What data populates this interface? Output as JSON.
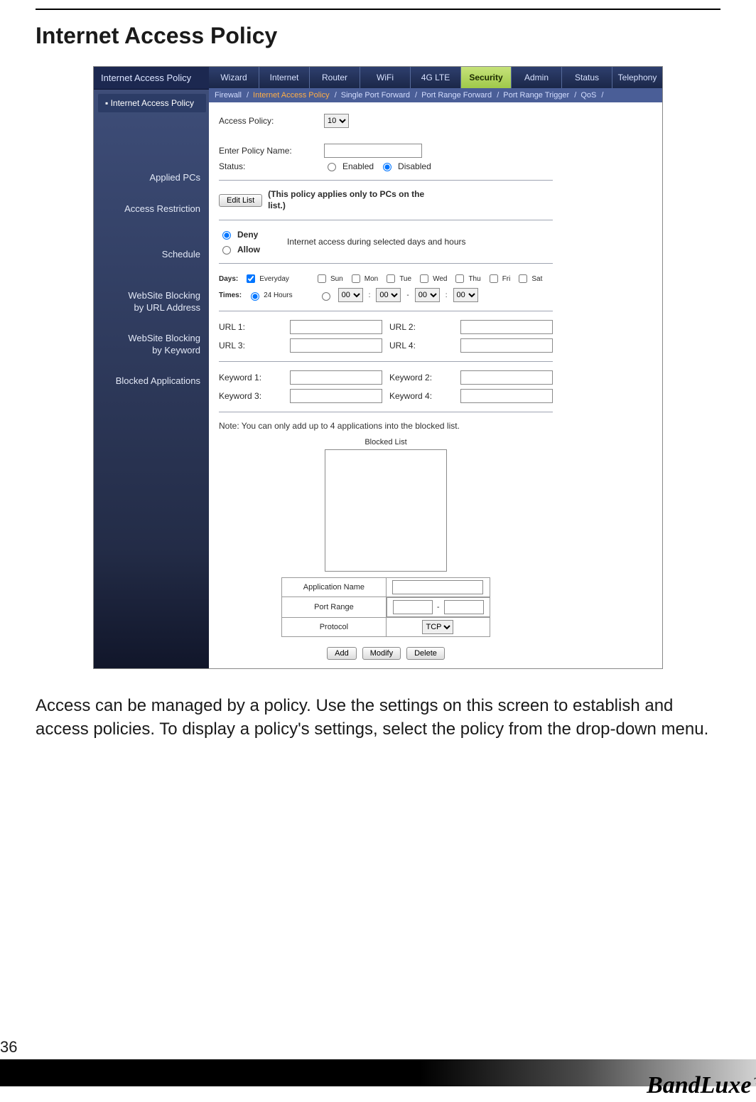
{
  "page": {
    "title": "Internet Access Policy",
    "number": "36",
    "brand": "BandLuxe",
    "tm": "TM",
    "body_paragraph": "Access can be managed by a policy. Use the settings on this screen to establish and access policies. To display a policy's settings, select the policy from the drop-down menu."
  },
  "left_pane": {
    "header": "Internet Access Policy",
    "active_item": "Internet Access Policy",
    "sections": {
      "applied_pcs": "Applied PCs",
      "access_restriction": "Access Restriction",
      "schedule": "Schedule",
      "website_url_1": "WebSite Blocking",
      "website_url_2": "by URL Address",
      "website_kw_1": "WebSite Blocking",
      "website_kw_2": "by Keyword",
      "blocked_apps": "Blocked Applications"
    }
  },
  "tabs": {
    "items": [
      "Wizard",
      "Internet",
      "Router",
      "WiFi",
      "4G LTE",
      "Security",
      "Admin",
      "Status",
      "Telephony"
    ],
    "active_index": 5
  },
  "subtabs": {
    "items": [
      "Firewall",
      "Internet Access Policy",
      "Single Port Forward",
      "Port Range Forward",
      "Port Range Trigger",
      "QoS"
    ],
    "active_index": 1
  },
  "form": {
    "access_policy_label": "Access Policy:",
    "access_policy_value": "10",
    "enter_policy_label": "Enter Policy Name:",
    "enter_policy_value": "",
    "status_label": "Status:",
    "status_enabled": "Enabled",
    "status_disabled": "Disabled",
    "edit_list_btn": "Edit List",
    "applied_note": "(This policy applies only to PCs on the list.)",
    "deny": "Deny",
    "allow": "Allow",
    "access_note": "Internet access during selected days and hours",
    "days_label": "Days:",
    "times_label": "Times:",
    "everyday": "Everyday",
    "hours24": "24 Hours",
    "day_names": [
      "Sun",
      "Mon",
      "Tue",
      "Wed",
      "Thu",
      "Fri",
      "Sat"
    ],
    "time_vals": [
      "00",
      "00",
      "00",
      "00"
    ],
    "url_labels": [
      "URL 1:",
      "URL 2:",
      "URL 3:",
      "URL 4:"
    ],
    "kw_labels": [
      "Keyword 1:",
      "Keyword 2:",
      "Keyword 3:",
      "Keyword 4:"
    ],
    "blocked_note": "Note: You can only add up to 4 applications into the blocked list.",
    "blocked_list_title": "Blocked List",
    "app_name_label": "Application Name",
    "port_range_label": "Port Range",
    "port_range_sep": "-",
    "protocol_label": "Protocol",
    "protocol_value": "TCP",
    "btn_add": "Add",
    "btn_modify": "Modify",
    "btn_delete": "Delete"
  }
}
